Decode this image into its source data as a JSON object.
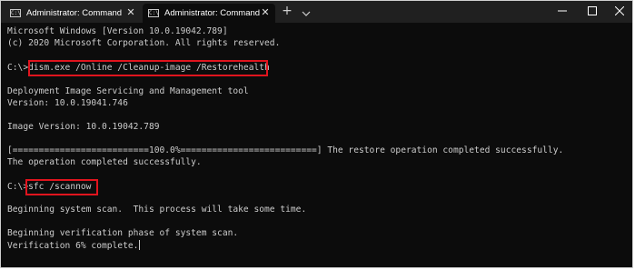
{
  "tabs": [
    {
      "title": "Administrator: Command Promp",
      "icon": "terminal-icon",
      "active": false
    },
    {
      "title": "Administrator: Command Promp",
      "icon": "terminal-icon",
      "active": true
    }
  ],
  "tab_icon_text": "C:\\",
  "close_glyph": "✕",
  "new_tab_glyph": "+",
  "console": {
    "line_1": "Microsoft Windows [Version 10.0.19042.789]",
    "line_2": "(c) 2020 Microsoft Corporation. All rights reserved.",
    "prompt_1": "C:\\>",
    "command_1": "dism.exe /Online /Cleanup-image /Restorehealth",
    "tool_name": "Deployment Image Servicing and Management tool",
    "tool_version": "Version: 10.0.19041.746",
    "image_version": "Image Version: 10.0.19042.789",
    "progress_line": "[==========================100.0%==========================] The restore operation completed successfully.",
    "operation_done": "The operation completed successfully.",
    "prompt_2": "C:\\>",
    "command_2": "sfc /scannow",
    "scan_begin": "Beginning system scan.  This process will take some time.",
    "verify_begin": "Beginning verification phase of system scan.",
    "verify_progress": "Verification 6% complete."
  },
  "colors": {
    "console_bg": "#0c0c0c",
    "console_text": "#cccccc",
    "titlebar_bg": "#202020",
    "highlight_border": "#e0141e"
  }
}
